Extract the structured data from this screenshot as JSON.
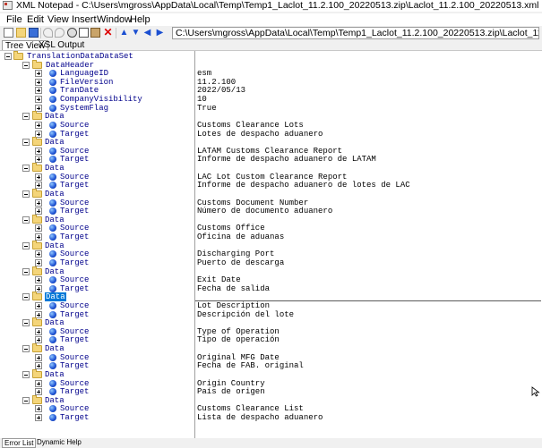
{
  "window": {
    "title": "XML Notepad - C:\\Users\\mgross\\AppData\\Local\\Temp\\Temp1_Laclot_11.2.100_20220513.zip\\Laclot_11.2.100_20220513.xml"
  },
  "menu": [
    "File",
    "Edit",
    "View",
    "Insert",
    "Window",
    "Help"
  ],
  "toolbar_icons": [
    "new-icon",
    "open-icon",
    "save-icon",
    "undo-icon",
    "redo-icon",
    "cut-icon",
    "copy-icon",
    "paste-icon",
    "delete-icon",
    "nudge-up-icon",
    "nudge-down-icon",
    "nudge-left-icon",
    "nudge-right-icon"
  ],
  "path": "C:\\Users\\mgross\\AppData\\Local\\Temp\\Temp1_Laclot_11.2.100_20220513.zip\\Laclot_11.2.100_20220513.xml",
  "tabs": [
    "Tree View",
    "XSL Output"
  ],
  "root": "TranslationDataDataSet",
  "header": {
    "label": "DataHeader",
    "fields": [
      {
        "name": "LanguageID",
        "value": "esm"
      },
      {
        "name": "FileVersion",
        "value": "11.2.100"
      },
      {
        "name": "TranDate",
        "value": "2022/05/13"
      },
      {
        "name": "CompanyVisibility",
        "value": "10"
      },
      {
        "name": "SystemFlag",
        "value": "True"
      }
    ]
  },
  "data_label": "Data",
  "source_label": "Source",
  "target_label": "Target",
  "entries": [
    {
      "source": "Customs Clearance Lots",
      "target": "Lotes de despacho aduanero"
    },
    {
      "source": "LATAM Customs Clearance Report",
      "target": "Informe de despacho aduanero de LATAM"
    },
    {
      "source": "LAC Lot Custom Clearance Report",
      "target": "Informe de despacho aduanero de lotes de LAC"
    },
    {
      "source": "Customs Document Number",
      "target": "Número de documento aduanero"
    },
    {
      "source": "Customs Office",
      "target": "Oficina de aduanas"
    },
    {
      "source": "Discharging Port",
      "target": "Puerto de descarga"
    },
    {
      "source": "Exit Date",
      "target": "Fecha de salida"
    },
    {
      "source": "Lot Description",
      "target": "Descripción del lote"
    },
    {
      "source": "Type of Operation",
      "target": "Tipo de operación"
    },
    {
      "source": "Original MFG Date",
      "target": "Fecha de FAB. original"
    },
    {
      "source": "Origin Country",
      "target": "País de origen"
    },
    {
      "source": "Customs Clearance List",
      "target": "Lista de despacho aduanero"
    }
  ],
  "selected_entry": 7,
  "bottom_tabs": [
    "Error List",
    "Dynamic Help"
  ],
  "colors": {
    "selection": "#0078d7",
    "attribute_text": "#00008b",
    "element_text": "#8b0000"
  }
}
